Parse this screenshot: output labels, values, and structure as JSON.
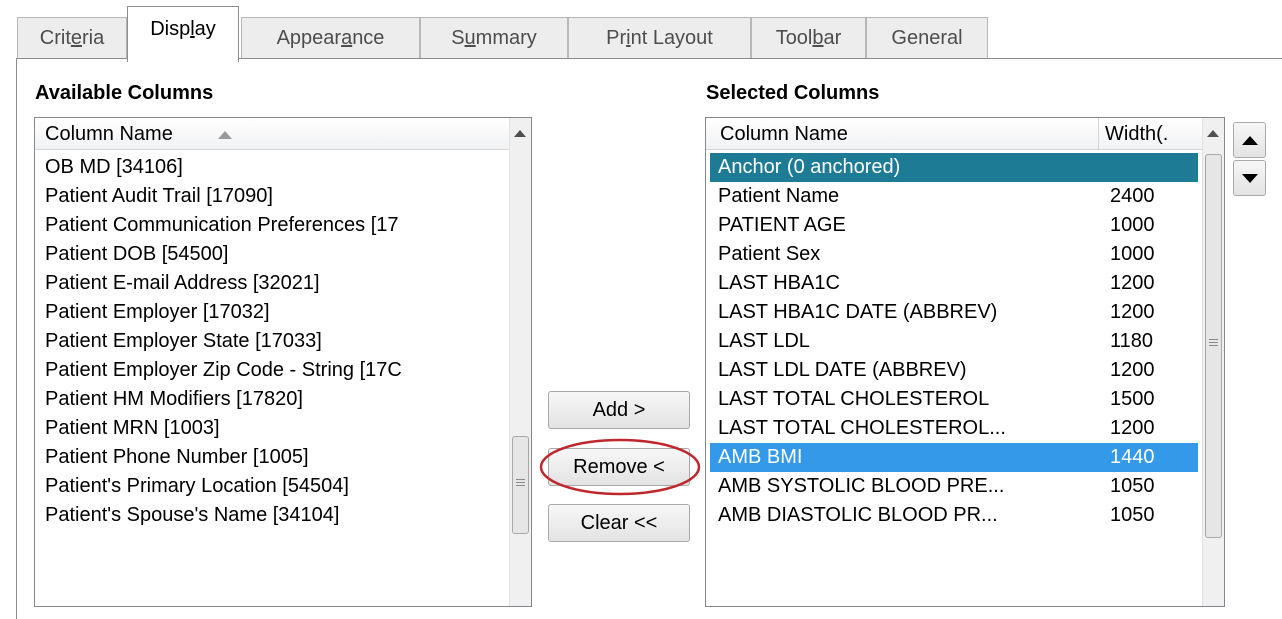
{
  "tabs": [
    {
      "label": "Criteria",
      "mnemonic_index": 4
    },
    {
      "label": "Display",
      "mnemonic_index": 4,
      "active": true
    },
    {
      "label": "Appearance",
      "mnemonic_index": 6
    },
    {
      "label": "Summary",
      "mnemonic_index": 1
    },
    {
      "label": "Print Layout",
      "mnemonic_index": 2
    },
    {
      "label": "Toolbar",
      "mnemonic_index": 4
    },
    {
      "label": "General",
      "mnemonic_index": -1
    }
  ],
  "available": {
    "heading": "Available Columns",
    "column_header": "Column Name",
    "sort_icon": "sort-ascending-icon",
    "items": [
      "OB MD [34106]",
      "Patient Audit Trail [17090]",
      "Patient Communication Preferences [17",
      "Patient DOB [54500]",
      "Patient E-mail Address [32021]",
      "Patient Employer [17032]",
      "Patient Employer State [17033]",
      "Patient Employer Zip Code - String [17C",
      "Patient HM Modifiers [17820]",
      "Patient MRN [1003]",
      "Patient Phone Number [1005]",
      "Patient's Primary Location [54504]",
      "Patient's Spouse's Name [34104]"
    ]
  },
  "buttons": {
    "add": "Add >",
    "remove": "Remove <",
    "clear": "Clear <<"
  },
  "selected": {
    "heading": "Selected Columns",
    "col_name_header": "Column Name",
    "col_width_header": "Width(.",
    "rows": [
      {
        "name": "Anchor (0 anchored)",
        "width": "",
        "style": "anchor"
      },
      {
        "name": "Patient Name",
        "width": "2400"
      },
      {
        "name": "PATIENT AGE",
        "width": "1000"
      },
      {
        "name": "Patient Sex",
        "width": "1000"
      },
      {
        "name": "LAST HBA1C",
        "width": "1200"
      },
      {
        "name": "LAST HBA1C DATE (ABBREV)",
        "width": "1200"
      },
      {
        "name": "LAST LDL",
        "width": "1180"
      },
      {
        "name": "LAST LDL DATE (ABBREV)",
        "width": "1200"
      },
      {
        "name": "LAST TOTAL CHOLESTEROL",
        "width": "1500"
      },
      {
        "name": "LAST TOTAL CHOLESTEROL...",
        "width": "1200"
      },
      {
        "name": "AMB BMI",
        "width": "1440",
        "style": "selected"
      },
      {
        "name": "AMB SYSTOLIC BLOOD PRE...",
        "width": "1050"
      },
      {
        "name": "AMB DIASTOLIC BLOOD PR...",
        "width": "1050"
      }
    ]
  },
  "colors": {
    "anchor_row": "#1e7b96",
    "selected_row": "#3399e8",
    "highlight_ellipse": "#c0272d"
  }
}
